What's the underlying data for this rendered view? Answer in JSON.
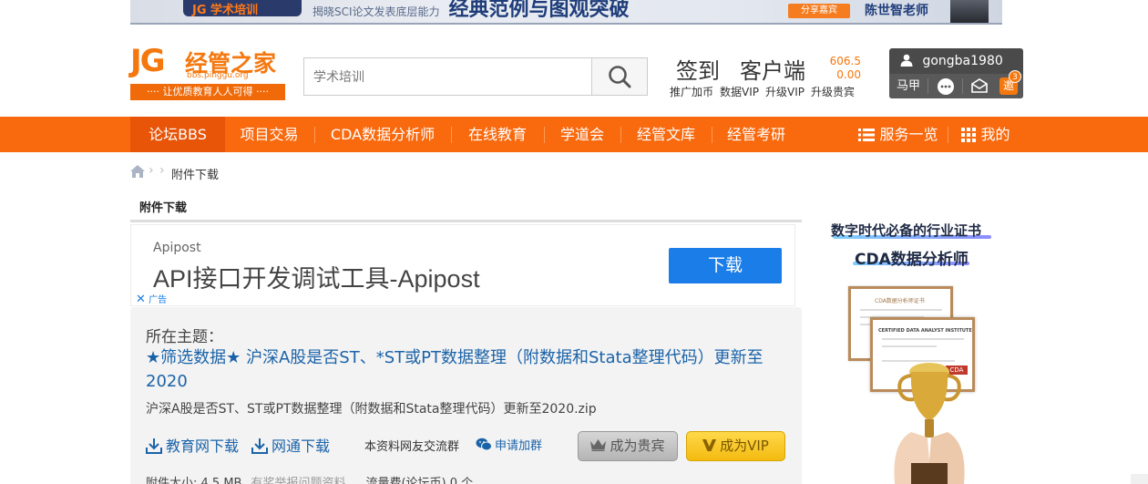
{
  "banner": {
    "logo_text": "JG 学术培训",
    "headline": "经典范例与图观突破",
    "subtext": "揭晓SCI论文发表底层能力",
    "share_label": "分享嘉宾",
    "teacher": "陈世智老师"
  },
  "logo": {
    "mark": "JG",
    "name": "经管之家",
    "url": "bbs.pinggu.org",
    "slogan": "···· 让优质教育人人可得 ····"
  },
  "search": {
    "placeholder": "学术培训"
  },
  "header": {
    "signin": "签到",
    "client": "客户端",
    "num1": "606.5",
    "num2": "0.00",
    "links": [
      "推广加币",
      "数据VIP",
      "升级VIP",
      "升级贵宾"
    ]
  },
  "user": {
    "name": "gongba1980",
    "rank": "马甲",
    "invite": "邀",
    "badge_count": "3"
  },
  "nav": {
    "items": [
      "论坛BBS",
      "项目交易",
      "CDA数据分析师",
      "在线教育",
      "学道会",
      "经管文库",
      "经管考研"
    ],
    "services": "服务一览",
    "mine": "我的"
  },
  "breadcrumb": {
    "current": "附件下载"
  },
  "section": {
    "title": "附件下载"
  },
  "ad": {
    "brand": "Apipost",
    "title": "API接口开发调试工具-Apipost",
    "button": "下载",
    "mark": "广告"
  },
  "content": {
    "topic_label": "所在主题：",
    "topic_title": "★筛选数据★ 沪深A股是否ST、*ST或PT数据整理（附数据和Stata整理代码）更新至2020",
    "filename": "沪深A股是否ST、ST或PT数据整理（附数据和Stata整理代码）更新至2020.zip",
    "download_edu": "教育网下载",
    "download_net": "网通下载",
    "group_text": "本资料网友交流群",
    "apply_join": "申请加群",
    "btn_guest": "成为贵宾",
    "btn_vip": "成为VIP",
    "attach_size": "附件大小: 4.5 MB",
    "report": "有奖举报问题资料",
    "traffic": "流量费(论坛币) 0 个"
  },
  "sidebar": {
    "title1": "数字时代必备的行业证书",
    "title2": "CDA数据分析师",
    "cert_label": "CDA数据分析师证书",
    "cert_heading": "CERTIFIED DATA ANALYST INSTITUTE",
    "cert_logo": "CDA"
  },
  "colors": {
    "brand_orange": "#f9690e",
    "link_blue": "#1b63a8",
    "ad_blue": "#1a7de8",
    "vip_gold": "#f3bb10"
  }
}
